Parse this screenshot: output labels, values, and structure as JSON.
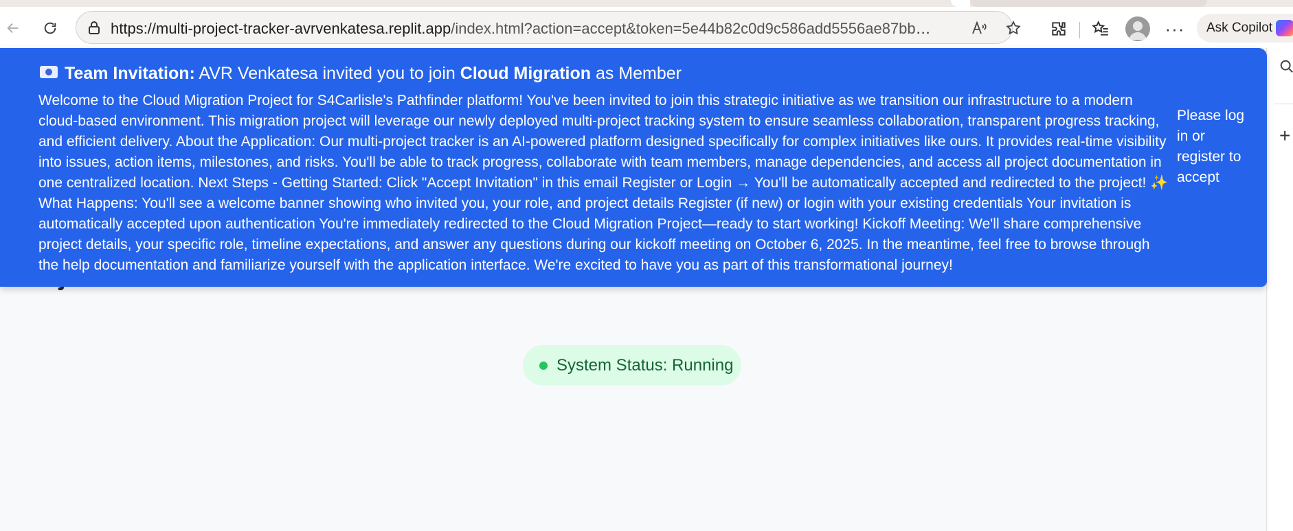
{
  "browser": {
    "url_host": "https://multi-project-tracker-avrvenkatesa.replit.app",
    "url_path": "/index.html?action=accept&token=5e44b82c0d9c586add5556ae87bb2c211739...",
    "read_aloud_icon": "read-aloud-icon",
    "copilot_label": "Ask Copilot"
  },
  "invitation": {
    "prefix": "Team Invitation:",
    "inviter_text": "AVR Venkatesa invited you to join",
    "project": "Cloud Migration",
    "role_text": "as Member",
    "message": "Welcome to the Cloud Migration Project for S4Carlisle's Pathfinder platform! You've been invited to join this strategic initiative as we transition our infrastructure to a modern cloud-based environment. This migration project will leverage our newly deployed multi-project tracking system to ensure seamless collaboration, transparent progress tracking, and efficient delivery. About the Application: Our multi-project tracker is an AI-powered platform designed specifically for complex initiatives like ours. It provides real-time visibility into issues, action items, milestones, and risks. You'll be able to track progress, collaborate with team members, manage dependencies, and access all project documentation in one centralized location. Next Steps - Getting Started: Click \"Accept Invitation\" in this email Register or Login → You'll be automatically accepted and redirected to the project! ✨ What Happens: You'll see a welcome banner showing who invited you, your role, and project details Register (if new) or login with your existing credentials Your invitation is automatically accepted upon authentication You're immediately redirected to the Cloud Migration Project—ready to start working! Kickoff Meeting: We'll share comprehensive project details, your specific role, timeline expectations, and answer any questions during our kickoff meeting on October 6, 2025. In the meantime, feel free to browse through the help documentation and familiarize yourself with the application interface. We're excited to have you as part of this transformational journey!",
    "cta": "Please log in or register to accept"
  },
  "page": {
    "title": "Projects",
    "status_text": "System Status: Running"
  },
  "colors": {
    "banner": "#2563eb",
    "status_bg": "#dcfce7",
    "status_dot": "#22c55e"
  }
}
